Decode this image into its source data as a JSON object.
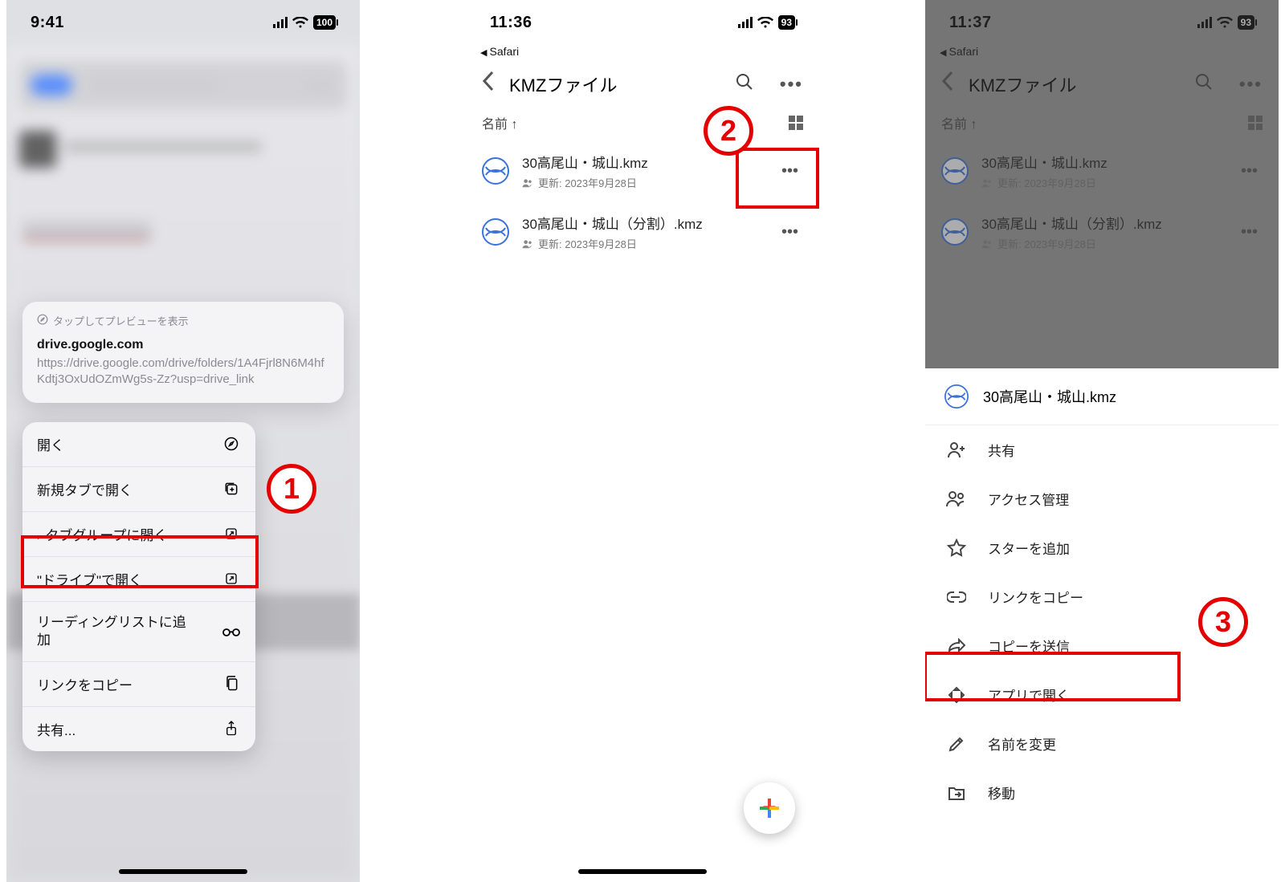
{
  "screen1": {
    "time": "9:41",
    "battery": "100",
    "preview": {
      "hint": "タップしてプレビューを表示",
      "title": "drive.google.com",
      "url": "https://drive.google.com/drive/folders/1A4Fjrl8N6M4hfKdtj3OxUdOZmWg5s-Zz?usp=drive_link"
    },
    "menu": {
      "open": "開く",
      "new_tab": "新規タブで開く",
      "tab_group": "タブグループに開く",
      "open_in_drive": "\"ドライブ\"で開く",
      "reading_list": "リーディングリストに追加",
      "copy_link": "リンクをコピー",
      "share": "共有..."
    },
    "callout": "1"
  },
  "screen2": {
    "time": "11:36",
    "battery": "93",
    "breadcrumb": "Safari",
    "title": "KMZファイル",
    "sort_label": "名前 ↑",
    "files": [
      {
        "name": "30高尾山・城山.kmz",
        "sub": "更新: 2023年9月28日"
      },
      {
        "name": "30高尾山・城山（分割）.kmz",
        "sub": "更新: 2023年9月28日"
      }
    ],
    "callout": "2"
  },
  "screen3": {
    "time": "11:37",
    "battery": "93",
    "breadcrumb": "Safari",
    "title": "KMZファイル",
    "sort_label": "名前 ↑",
    "files": [
      {
        "name": "30高尾山・城山.kmz",
        "sub": "更新: 2023年9月28日"
      },
      {
        "name": "30高尾山・城山（分割）.kmz",
        "sub": "更新: 2023年9月28日"
      }
    ],
    "sheet": {
      "title": "30高尾山・城山.kmz",
      "items": {
        "share": "共有",
        "manage_access": "アクセス管理",
        "add_star": "スターを追加",
        "copy_link": "リンクをコピー",
        "send_copy": "コピーを送信",
        "open_in_app": "アプリで開く",
        "rename": "名前を変更",
        "move": "移動"
      }
    },
    "callout": "3"
  }
}
